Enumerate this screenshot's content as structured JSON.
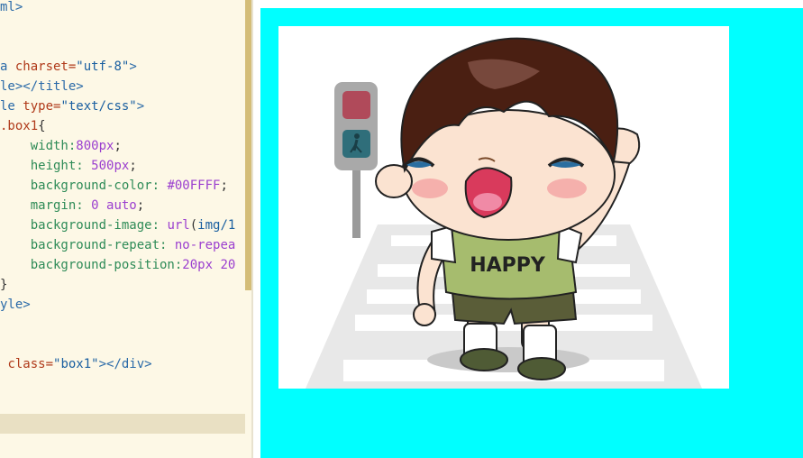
{
  "editor": {
    "lines": [
      {
        "parts": [
          {
            "t": "ml>",
            "c": "tag"
          }
        ]
      },
      {
        "parts": []
      },
      {
        "parts": []
      },
      {
        "parts": [
          {
            "t": "a ",
            "c": "tag"
          },
          {
            "t": "charset=",
            "c": "attr"
          },
          {
            "t": "\"utf-8\"",
            "c": "str"
          },
          {
            "t": ">",
            "c": "tag"
          }
        ]
      },
      {
        "parts": [
          {
            "t": "le></title>",
            "c": "tag"
          }
        ]
      },
      {
        "parts": [
          {
            "t": "le ",
            "c": "tag"
          },
          {
            "t": "type=",
            "c": "attr"
          },
          {
            "t": "\"text/css\"",
            "c": "str"
          },
          {
            "t": ">",
            "c": "tag"
          }
        ]
      },
      {
        "parts": [
          {
            "t": ".box1",
            "c": "sel"
          },
          {
            "t": "{",
            "c": "punc"
          }
        ]
      },
      {
        "parts": [
          {
            "t": "    width:",
            "c": "prop"
          },
          {
            "t": "800px",
            "c": "val"
          },
          {
            "t": ";",
            "c": "punc"
          }
        ]
      },
      {
        "parts": [
          {
            "t": "    height: ",
            "c": "prop"
          },
          {
            "t": "500px",
            "c": "val"
          },
          {
            "t": ";",
            "c": "punc"
          }
        ]
      },
      {
        "parts": [
          {
            "t": "    background-color: ",
            "c": "prop"
          },
          {
            "t": "#00FFFF",
            "c": "val"
          },
          {
            "t": ";",
            "c": "punc"
          }
        ]
      },
      {
        "parts": [
          {
            "t": "    margin: ",
            "c": "prop"
          },
          {
            "t": "0 auto",
            "c": "val"
          },
          {
            "t": ";",
            "c": "punc"
          }
        ]
      },
      {
        "parts": [
          {
            "t": "    background-image: ",
            "c": "prop"
          },
          {
            "t": "url",
            "c": "val"
          },
          {
            "t": "(",
            "c": "punc"
          },
          {
            "t": "img/1",
            "c": "str"
          }
        ]
      },
      {
        "parts": [
          {
            "t": "    background-repeat: ",
            "c": "prop"
          },
          {
            "t": "no-repea",
            "c": "val"
          }
        ]
      },
      {
        "parts": [
          {
            "t": "    background-position:",
            "c": "prop"
          },
          {
            "t": "20px 20",
            "c": "val"
          }
        ]
      },
      {
        "parts": [
          {
            "t": "}",
            "c": "punc"
          }
        ]
      },
      {
        "parts": [
          {
            "t": "yle>",
            "c": "tag"
          }
        ]
      },
      {
        "parts": []
      },
      {
        "parts": []
      },
      {
        "parts": [
          {
            "t": " ",
            "c": "punc"
          },
          {
            "t": "class=",
            "c": "attr"
          },
          {
            "t": "\"box1\"",
            "c": "str"
          },
          {
            "t": "></div>",
            "c": "tag"
          }
        ]
      }
    ]
  },
  "preview": {
    "box_color": "#00ffff",
    "image": {
      "shirt_text": "HAPPY",
      "subject": "cartoon boy waving on crosswalk with traffic light"
    }
  }
}
